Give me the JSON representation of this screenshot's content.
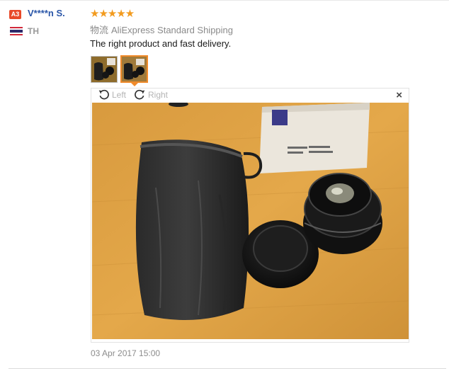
{
  "reviewer": {
    "level_badge": "A3",
    "name": "V****n S.",
    "country": "TH",
    "flag_icon": "thailand-flag-icon"
  },
  "review": {
    "rating": 5,
    "stars_text": "★★★★★",
    "shipping_label": "物流",
    "shipping_method": "AliExpress Standard Shipping",
    "text": "The right product and fast delivery.",
    "date": "03 Apr 2017 15:00"
  },
  "viewer": {
    "rotate_left_label": "Left",
    "rotate_right_label": "Right",
    "close_label": "×",
    "selected_thumbnail": 2
  },
  "colors": {
    "name": "#2a56a8",
    "badge": "#e84a2a",
    "stars": "#f29b1f",
    "selected_border": "#f08a2a"
  }
}
